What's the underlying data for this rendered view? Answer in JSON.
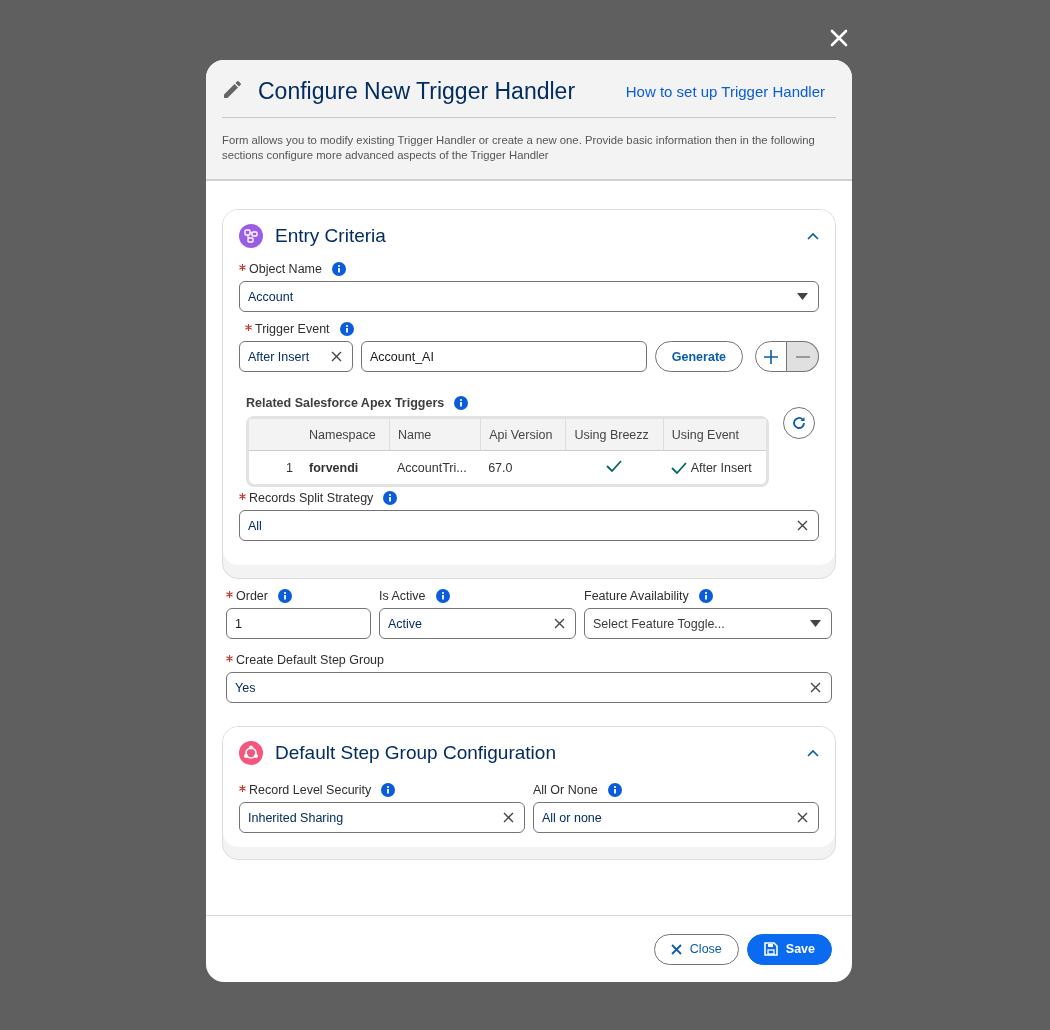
{
  "modal": {
    "title": "Configure New Trigger Handler",
    "help_link": "How to set up Trigger Handler",
    "description": "Form allows you to modify existing Trigger Handler or create a new one. Provide basic information then in the following sections configure more advanced aspects of the Trigger Handler"
  },
  "entry_criteria": {
    "title": "Entry Criteria",
    "expanded": true,
    "object_name": {
      "label": "Object Name",
      "required": true,
      "kind": "dropdown",
      "value": "Account"
    },
    "trigger_event": {
      "label": "Trigger Event",
      "required": true,
      "event_value": "After Insert",
      "name_value": "Account_AI",
      "generate_button": "Generate",
      "remove_disabled": true
    },
    "apex_triggers": {
      "label": "Related Salesforce Apex Triggers",
      "columns": [
        "Namespace",
        "Name",
        "Api Version",
        "Using Breezz",
        "Using Event"
      ],
      "rows": [
        {
          "index": "1",
          "namespace": "forvendi",
          "name": "AccountTri...",
          "api_version": "67.0",
          "using_breezz": true,
          "using_event": true,
          "event": "After Insert"
        }
      ]
    },
    "split_strategy": {
      "label": "Records Split Strategy",
      "required": true,
      "kind": "clearable",
      "value": "All"
    }
  },
  "settings_row": [
    {
      "label": "Order",
      "required": true,
      "kind": "text",
      "value": "1"
    },
    {
      "label": "Is Active",
      "required": false,
      "kind": "clearable",
      "value": "Active"
    },
    {
      "label": "Feature Availability",
      "required": false,
      "kind": "dropdown",
      "placeholder": "Select Feature Toggle..."
    }
  ],
  "create_default_step_group": {
    "label": "Create Default Step Group",
    "required": true,
    "kind": "clearable",
    "value": "Yes"
  },
  "step_group": {
    "title": "Default Step Group Configuration",
    "expanded": true,
    "fields": [
      {
        "label": "Record Level Security",
        "required": true,
        "kind": "clearable",
        "value": "Inherited Sharing"
      },
      {
        "label": "All Or None",
        "required": false,
        "kind": "clearable",
        "value": "All or none"
      }
    ]
  },
  "footer": {
    "close_button": "Close",
    "save_button": "Save"
  }
}
